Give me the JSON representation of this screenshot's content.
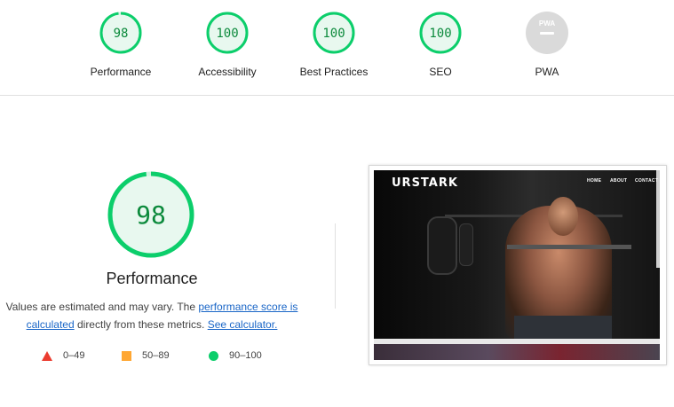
{
  "categories": [
    {
      "score": "98",
      "label": "Performance",
      "value": 98,
      "color": "#0cce6b"
    },
    {
      "score": "100",
      "label": "Accessibility",
      "value": 100,
      "color": "#0cce6b"
    },
    {
      "score": "100",
      "label": "Best Practices",
      "value": 100,
      "color": "#0cce6b"
    },
    {
      "score": "100",
      "label": "SEO",
      "value": 100,
      "color": "#0cce6b"
    },
    {
      "score": "PWA",
      "label": "PWA",
      "value": null,
      "color": "#cccccc"
    }
  ],
  "main": {
    "score": "98",
    "value": 98,
    "title": "Performance",
    "desc_prefix": "Values are estimated and may vary. The ",
    "desc_link1": "performance score is calculated",
    "desc_middle": " directly from these metrics. ",
    "desc_link2": "See calculator."
  },
  "legend": [
    {
      "range": "0–49",
      "shape": "triangle",
      "color": "#eb3c2f"
    },
    {
      "range": "50–89",
      "shape": "square",
      "color": "#ffa733"
    },
    {
      "range": "90–100",
      "shape": "circle",
      "color": "#0cce6b"
    }
  ],
  "screenshot": {
    "brand": "URSTARK",
    "nav": [
      "HOME",
      "ABOUT",
      "CONTACT"
    ]
  }
}
